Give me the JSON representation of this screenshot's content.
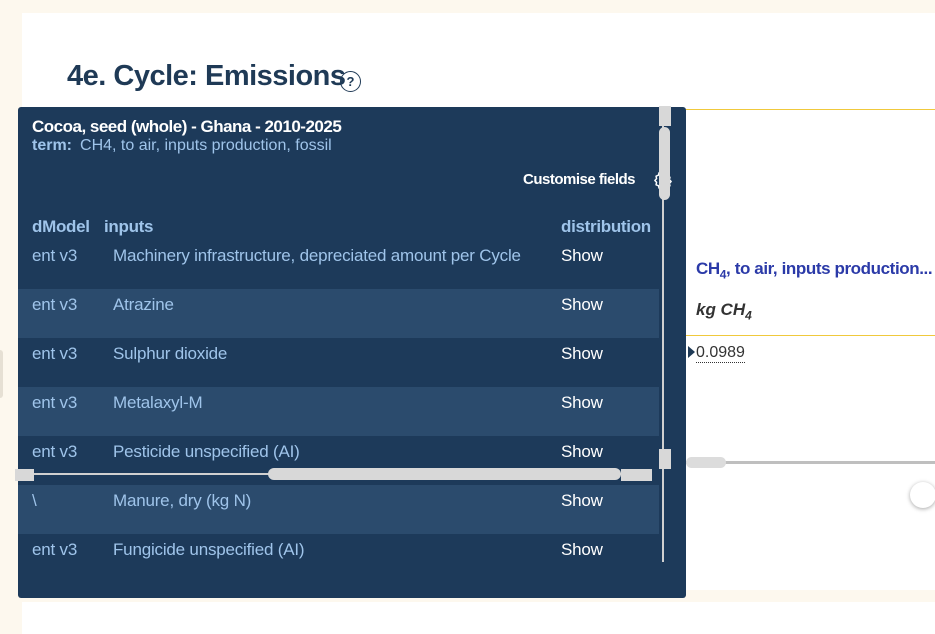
{
  "section": {
    "title": "4e. Cycle: Emissions",
    "help_glyph": "?"
  },
  "background_table": {
    "header_term": "CH",
    "header_term_sub": "4",
    "header_term_rest": ", to air, inputs production...",
    "unit": "kg CH",
    "unit_sub": "4",
    "value": "0.0989"
  },
  "tooltip": {
    "title": "Cocoa, seed (whole) - Ghana - 2010-2025",
    "term_label": "term:",
    "term_value": "CH4, to air, inputs production, fossil",
    "customise_label": "Customise fields",
    "columns": [
      "dModel",
      "inputs",
      "distribution"
    ],
    "rows": [
      {
        "model": "ent v3",
        "input": "Machinery infrastructure, depreciated amount per Cycle",
        "distribution": "Show"
      },
      {
        "model": "ent v3",
        "input": "Atrazine",
        "distribution": "Show"
      },
      {
        "model": "ent v3",
        "input": "Sulphur dioxide",
        "distribution": "Show"
      },
      {
        "model": "ent v3",
        "input": "Metalaxyl-M",
        "distribution": "Show"
      },
      {
        "model": "ent v3",
        "input": "Pesticide unspecified (AI)",
        "distribution": "Show"
      },
      {
        "model": "\\",
        "input": "Manure, dry (kg N)",
        "distribution": "Show"
      },
      {
        "model": "ent v3",
        "input": "Fungicide unspecified (AI)",
        "distribution": "Show"
      }
    ]
  },
  "icons": {
    "help": "question-circle-icon",
    "settings": "gear-icon"
  },
  "colors": {
    "tooltip_bg": "#1d3a5a",
    "tooltip_row_alt": "#2b4b6d",
    "title_text": "#1f3a56",
    "accent_link": "#2b3aa8",
    "gold_rule": "#f0c93c"
  }
}
